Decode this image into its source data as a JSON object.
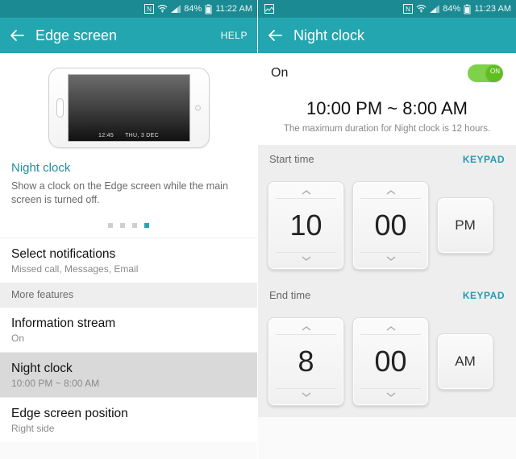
{
  "left": {
    "status": {
      "battery": "84%",
      "time": "11:22 AM"
    },
    "appbar": {
      "title": "Edge screen",
      "help": "HELP"
    },
    "phone_preview": {
      "clock": "12:45",
      "date": "THU, 3 DEC"
    },
    "card": {
      "title": "Night clock",
      "desc": "Show a clock on the Edge screen while the main screen is turned off."
    },
    "rows": {
      "select_notifications": {
        "title": "Select notifications",
        "sub": "Missed call, Messages, Email"
      },
      "more_features": "More features",
      "information_stream": {
        "title": "Information stream",
        "sub": "On"
      },
      "night_clock": {
        "title": "Night clock",
        "sub": "10:00 PM ~ 8:00 AM"
      },
      "edge_position": {
        "title": "Edge screen position",
        "sub": "Right side"
      }
    }
  },
  "right": {
    "status": {
      "battery": "84%",
      "time": "11:23 AM"
    },
    "appbar": {
      "title": "Night clock"
    },
    "on_label": "On",
    "toggle_text": "ON",
    "range": "10:00 PM ~ 8:00 AM",
    "note": "The maximum duration for Night clock is 12 hours.",
    "start_label": "Start time",
    "end_label": "End time",
    "keypad": "KEYPAD",
    "start": {
      "hour": "10",
      "minute": "00",
      "ampm": "PM"
    },
    "end": {
      "hour": "8",
      "minute": "00",
      "ampm": "AM"
    }
  }
}
